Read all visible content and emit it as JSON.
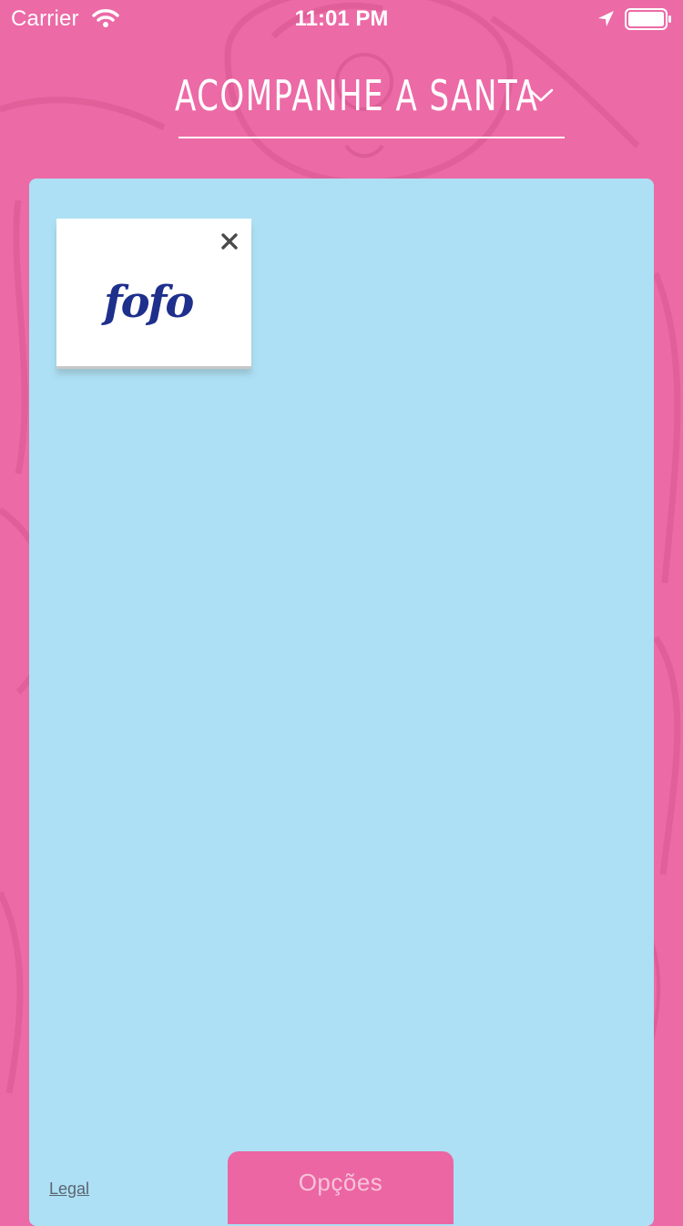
{
  "colors": {
    "background": "#ec6aa6",
    "panel": "#ade0f4",
    "accent": "#ec66a3",
    "button_text": "#f7c3da",
    "logo_blue": "#1e2f8c"
  },
  "status_bar": {
    "carrier": "Carrier",
    "time": "11:01 PM",
    "icons": [
      "wifi-icon",
      "location-arrow-icon",
      "battery-icon"
    ]
  },
  "header": {
    "title": "ACOMPANHE A SANTA",
    "dropdown_icon": "chevron-down-icon"
  },
  "card": {
    "logo_text": "fofo",
    "close_icon": "close-icon"
  },
  "footer": {
    "legal_label": "Legal",
    "options_label": "Opções"
  }
}
